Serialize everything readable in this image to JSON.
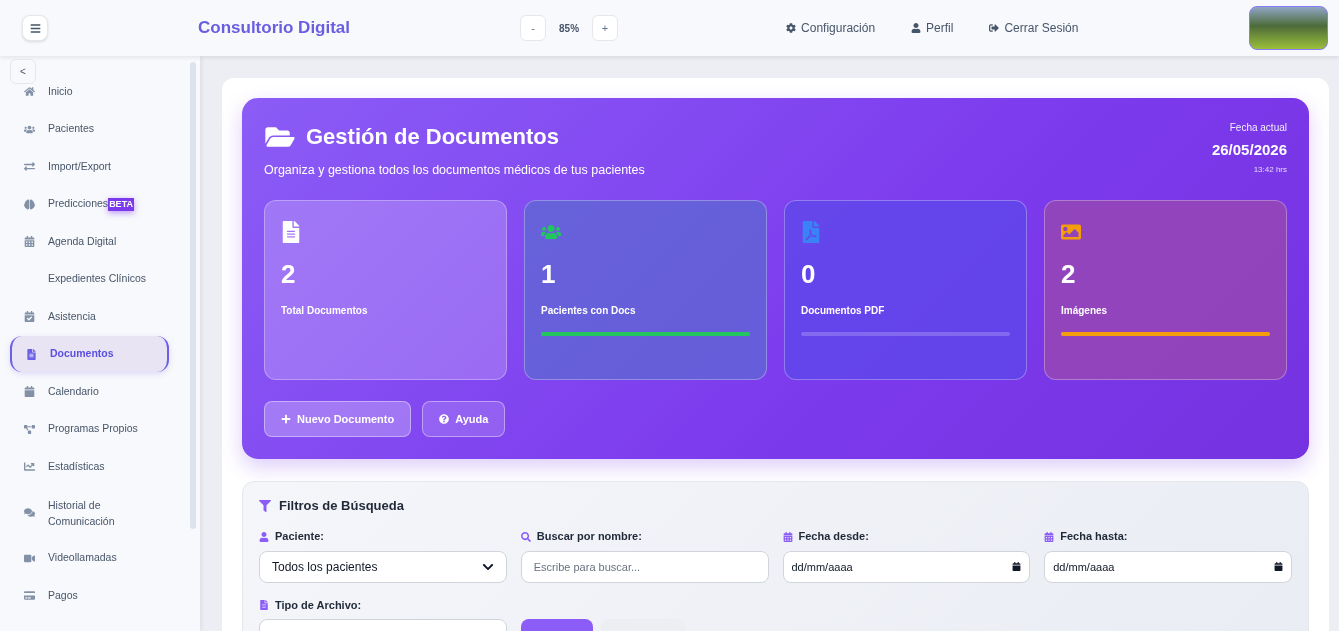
{
  "header": {
    "brand": "Consultorio Digital",
    "zoom": {
      "decrease": "-",
      "value": "85%",
      "increase": "+"
    },
    "nav": [
      {
        "label": "Configuración"
      },
      {
        "label": "Perfil"
      },
      {
        "label": "Cerrar Sesión"
      }
    ]
  },
  "sidebar": {
    "collapse": "<",
    "items": [
      {
        "label": "Inicio",
        "selected": false
      },
      {
        "label": "Pacientes",
        "selected": false
      },
      {
        "label": "Import/Export",
        "selected": false
      },
      {
        "label": "Predicciones",
        "badge": "BETA",
        "selected": false
      },
      {
        "label": "Agenda Digital",
        "selected": false
      },
      {
        "label": "Expedientes Clínicos",
        "selected": false
      },
      {
        "label": "Asistencia",
        "selected": false
      },
      {
        "label": "Documentos",
        "selected": true
      },
      {
        "label": "Calendario",
        "selected": false
      },
      {
        "label": "Programas Propios",
        "selected": false
      },
      {
        "label": "Estadísticas",
        "selected": false
      },
      {
        "label": "Historial de Comunicación",
        "selected": false
      },
      {
        "label": "Videollamadas",
        "selected": false
      },
      {
        "label": "Pagos",
        "selected": false
      }
    ]
  },
  "hero": {
    "title": "Gestión de Documentos",
    "subtitle": "Organiza y gestiona todos los documentos médicos de tus pacientes",
    "date_label": "Fecha actual",
    "date": "26/05/2026",
    "time": "13:42 hrs",
    "stats": [
      {
        "kind": "documents",
        "value": "2",
        "label": "Total Documentos"
      },
      {
        "kind": "patients",
        "value": "1",
        "label": "Pacientes con Docs",
        "bar": {
          "level": 1,
          "color": "#22c55e"
        }
      },
      {
        "kind": "pdf",
        "value": "0",
        "label": "Documentos PDF",
        "bar": {
          "level": 0
        }
      },
      {
        "kind": "images",
        "value": "2",
        "label": "Imágenes",
        "bar": {
          "level": 1,
          "color": "#f59e0b"
        }
      }
    ],
    "buttons": [
      {
        "kind": "add",
        "label": "Nuevo Documento"
      },
      {
        "kind": "help",
        "label": "Ayuda"
      }
    ]
  },
  "filters": {
    "title": "Filtros de Búsqueda",
    "fields": [
      {
        "kind": "select",
        "label": "Paciente:",
        "value": "Todos los pacientes"
      },
      {
        "kind": "search",
        "label": "Buscar por nombre:",
        "placeholder": "Escribe para buscar..."
      },
      {
        "kind": "date",
        "label": "Fecha desde:",
        "placeholder": "dd/mm/aaaa"
      },
      {
        "kind": "date",
        "label": "Fecha hasta:",
        "placeholder": "dd/mm/aaaa"
      },
      {
        "kind": "select",
        "label": "Tipo de Archivo:"
      }
    ],
    "buttons": [
      {
        "kind": "primary"
      },
      {
        "kind": "secondary"
      }
    ]
  }
}
